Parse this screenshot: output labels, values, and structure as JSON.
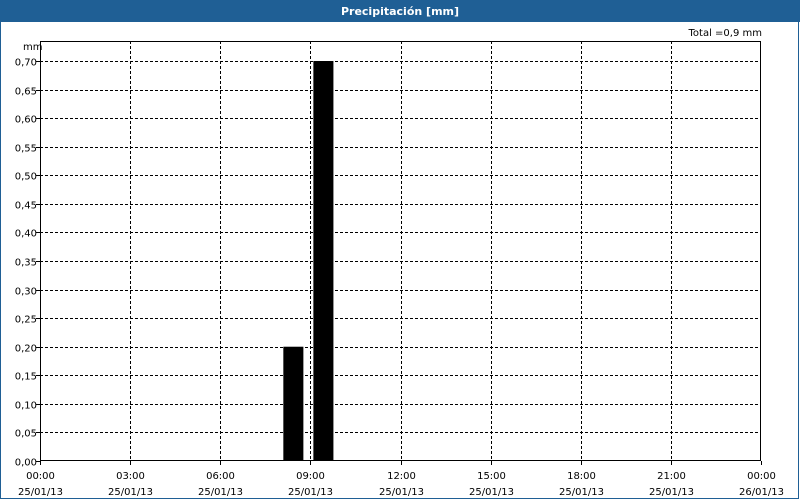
{
  "chart_data": {
    "type": "bar",
    "title": "Precipitación [mm]",
    "ylabel": "mm",
    "total_label": "Total =0,9 mm",
    "ylim": [
      0,
      0.7
    ],
    "yticks": [
      "0,00",
      "0,05",
      "0,10",
      "0,15",
      "0,20",
      "0,25",
      "0,30",
      "0,35",
      "0,40",
      "0,45",
      "0,50",
      "0,55",
      "0,60",
      "0,65",
      "0,70"
    ],
    "xlim_hours": [
      0,
      24
    ],
    "xticks": [
      {
        "time": "00:00",
        "date": "25/01/13"
      },
      {
        "time": "03:00",
        "date": "25/01/13"
      },
      {
        "time": "06:00",
        "date": "25/01/13"
      },
      {
        "time": "09:00",
        "date": "25/01/13"
      },
      {
        "time": "12:00",
        "date": "25/01/13"
      },
      {
        "time": "15:00",
        "date": "25/01/13"
      },
      {
        "time": "18:00",
        "date": "25/01/13"
      },
      {
        "time": "21:00",
        "date": "25/01/13"
      },
      {
        "time": "00:00",
        "date": "26/01/13"
      }
    ],
    "bars": [
      {
        "start_hour": 8.0,
        "end_hour": 9.0,
        "value": 0.2
      },
      {
        "start_hour": 9.0,
        "end_hour": 10.0,
        "value": 0.7
      }
    ],
    "grid": true,
    "bar_color": "#000000"
  }
}
